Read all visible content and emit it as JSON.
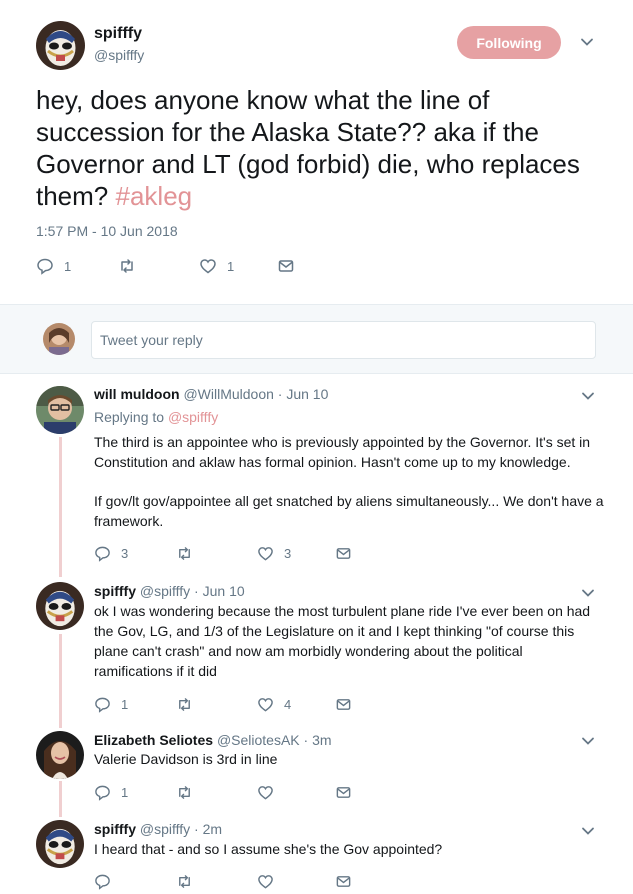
{
  "main_tweet": {
    "name": "spifffy",
    "handle": "@spifffy",
    "follow_label": "Following",
    "text_before": "hey, does anyone know what the line of succession for the Alaska State?? aka if the Governor and LT (god forbid) die, who replaces them? ",
    "hashtag": "#akleg",
    "timestamp": "1:57 PM - 10 Jun 2018",
    "reply_count": "1",
    "retweet_count": "",
    "like_count": "1"
  },
  "reply_box": {
    "placeholder": "Tweet your reply"
  },
  "replies": [
    {
      "name": "will muldoon",
      "handle_date": "@WillMuldoon · Jun 10",
      "replying_prefix": "Replying to ",
      "replying_to": "@spifffy",
      "text": "The third is an appointee who is previously appointed by the Governor. It's set in Constitution and aklaw has formal opinion. Hasn't come up to my knowledge.",
      "text2": "If gov/lt gov/appointee all get snatched by aliens simultaneously... We don't have a framework.",
      "reply_count": "3",
      "like_count": "3"
    },
    {
      "name": "spifffy",
      "handle_date": "@spifffy · Jun 10",
      "text": "ok I was wondering because the most turbulent plane ride I've ever been on had the Gov, LG, and 1/3 of the Legislature on it and I kept thinking \"of course this plane can't crash\" and now am morbidly wondering about the political ramifications if it did",
      "reply_count": "1",
      "like_count": "4"
    },
    {
      "name": "Elizabeth Seliotes",
      "handle_date": "@SeliotesAK · 3m",
      "text": "Valerie Davidson is 3rd in line",
      "reply_count": "1",
      "like_count": ""
    },
    {
      "name": "spifffy",
      "handle_date": "@spifffy · 2m",
      "text": "I heard that - and so I assume she's the Gov appointed?",
      "reply_count": "",
      "like_count": ""
    }
  ],
  "colors": {
    "accent_pink": "#e29396",
    "follow_button": "#e6a1a3",
    "thread_line": "#f0cfd0",
    "muted_text": "#657786"
  }
}
